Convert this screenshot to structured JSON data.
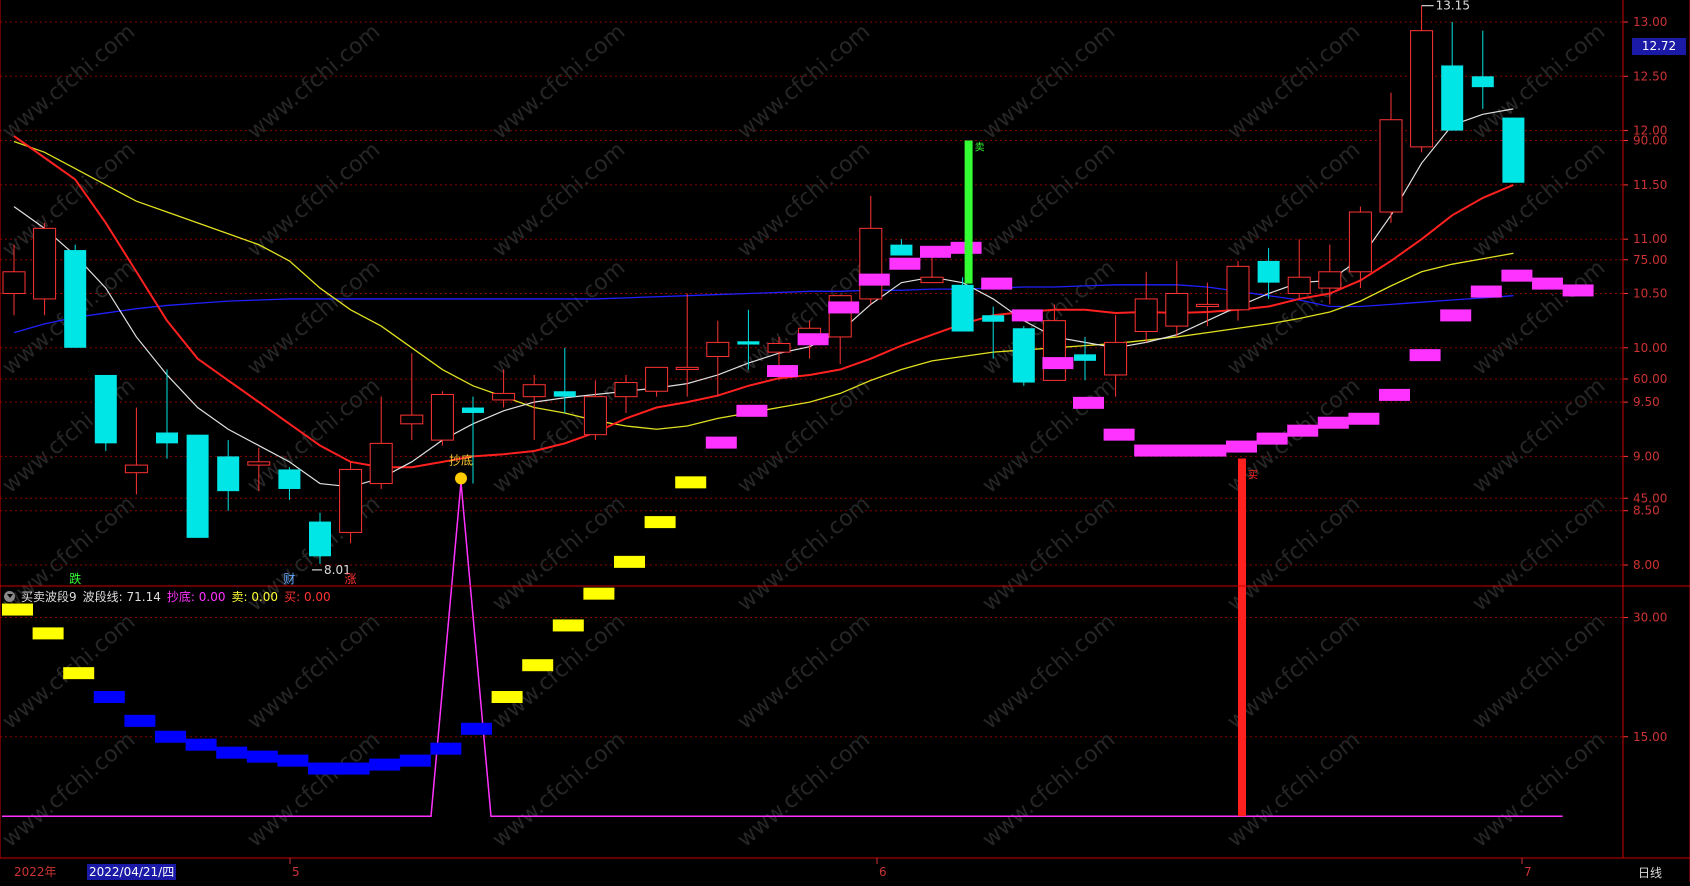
{
  "indicator": {
    "name": "买卖波段9",
    "items": [
      {
        "label": "波段线:",
        "value": "71.14",
        "cls": "lbl-w"
      },
      {
        "label": "抄底:",
        "value": "0.00",
        "cls": "lbl-m"
      },
      {
        "label": "卖:",
        "value": "0.00",
        "cls": "lbl-y"
      },
      {
        "label": "买:",
        "value": "0.00",
        "cls": "lbl-r"
      }
    ],
    "bottom_label": "抄底",
    "sell_mark": "卖",
    "buy_mark": "买"
  },
  "current_price": "12.72",
  "period_label": "日线",
  "dates": {
    "year": "2022年",
    "cursor_date": "2022/04/21/四",
    "months": [
      "5",
      "6",
      "7"
    ]
  },
  "watermark": "www.cfchi.com",
  "colors": {
    "up": "#ff3333",
    "down": "#00e5e5",
    "ma5": "#e0e0e0",
    "ma10": "#ff2020",
    "ma20": "#e0e020",
    "ma60": "#2020ff",
    "grid": "#8b0000",
    "osc_pink": "#ff33ff",
    "osc_yellow": "#ffff00",
    "osc_blue": "#0000ff"
  },
  "chart_data": [
    {
      "type": "candlestick",
      "y_ticks": [
        "13.00",
        "12.50",
        "12.00",
        "11.50",
        "11.00",
        "10.50",
        "10.00",
        "9.50",
        "9.00",
        "8.50",
        "8.00"
      ],
      "ylim": [
        7.9,
        13.2
      ],
      "annotations": {
        "high": "13.15",
        "low": "8.01"
      },
      "markers": [
        {
          "index": 2,
          "text": "跌",
          "color": "#33ff33"
        },
        {
          "index": 9,
          "text": "财",
          "color": "#66aaff"
        },
        {
          "index": 11,
          "text": "涨",
          "color": "#ff3333"
        }
      ],
      "candles": [
        {
          "o": 10.5,
          "h": 10.95,
          "l": 10.3,
          "c": 10.7
        },
        {
          "o": 10.45,
          "h": 11.15,
          "l": 10.3,
          "c": 11.1
        },
        {
          "o": 10.9,
          "h": 10.95,
          "l": 10.0,
          "c": 10.0
        },
        {
          "o": 9.75,
          "h": 9.75,
          "l": 9.05,
          "c": 9.12
        },
        {
          "o": 8.85,
          "h": 9.45,
          "l": 8.65,
          "c": 8.92
        },
        {
          "o": 9.22,
          "h": 9.8,
          "l": 8.98,
          "c": 9.12
        },
        {
          "o": 9.2,
          "h": 9.2,
          "l": 8.25,
          "c": 8.25
        },
        {
          "o": 9.0,
          "h": 9.15,
          "l": 8.5,
          "c": 8.68
        },
        {
          "o": 8.92,
          "h": 9.08,
          "l": 8.68,
          "c": 8.95
        },
        {
          "o": 8.88,
          "h": 8.9,
          "l": 8.6,
          "c": 8.7
        },
        {
          "o": 8.4,
          "h": 8.48,
          "l": 8.01,
          "c": 8.08
        },
        {
          "o": 8.3,
          "h": 8.95,
          "l": 8.2,
          "c": 8.88
        },
        {
          "o": 8.75,
          "h": 9.55,
          "l": 8.7,
          "c": 9.12
        },
        {
          "o": 9.3,
          "h": 9.95,
          "l": 9.15,
          "c": 9.38
        },
        {
          "o": 9.15,
          "h": 9.6,
          "l": 9.1,
          "c": 9.57
        },
        {
          "o": 9.45,
          "h": 9.55,
          "l": 8.75,
          "c": 9.4
        },
        {
          "o": 9.52,
          "h": 9.8,
          "l": 9.45,
          "c": 9.58
        },
        {
          "o": 9.55,
          "h": 9.75,
          "l": 9.15,
          "c": 9.66
        },
        {
          "o": 9.6,
          "h": 10.0,
          "l": 9.4,
          "c": 9.55
        },
        {
          "o": 9.2,
          "h": 9.7,
          "l": 9.15,
          "c": 9.55
        },
        {
          "o": 9.55,
          "h": 9.75,
          "l": 9.4,
          "c": 9.68
        },
        {
          "o": 9.6,
          "h": 9.8,
          "l": 9.55,
          "c": 9.82
        },
        {
          "o": 9.8,
          "h": 10.5,
          "l": 9.55,
          "c": 9.82
        },
        {
          "o": 9.92,
          "h": 10.25,
          "l": 9.55,
          "c": 10.05
        },
        {
          "o": 10.06,
          "h": 10.35,
          "l": 9.8,
          "c": 10.03
        },
        {
          "o": 9.96,
          "h": 10.1,
          "l": 9.7,
          "c": 10.04
        },
        {
          "o": 10.03,
          "h": 10.25,
          "l": 9.9,
          "c": 10.18
        },
        {
          "o": 10.1,
          "h": 10.48,
          "l": 9.85,
          "c": 10.48
        },
        {
          "o": 10.45,
          "h": 11.4,
          "l": 10.4,
          "c": 11.1
        },
        {
          "o": 10.95,
          "h": 11.0,
          "l": 10.85,
          "c": 10.85
        },
        {
          "o": 10.6,
          "h": 10.85,
          "l": 10.6,
          "c": 10.65
        },
        {
          "o": 10.58,
          "h": 10.65,
          "l": 10.15,
          "c": 10.15
        },
        {
          "o": 10.3,
          "h": 10.38,
          "l": 9.9,
          "c": 10.24
        },
        {
          "o": 10.18,
          "h": 10.2,
          "l": 9.65,
          "c": 9.68
        },
        {
          "o": 9.7,
          "h": 10.4,
          "l": 9.7,
          "c": 10.25
        },
        {
          "o": 9.94,
          "h": 10.1,
          "l": 9.7,
          "c": 9.88
        },
        {
          "o": 9.75,
          "h": 10.3,
          "l": 9.55,
          "c": 10.05
        },
        {
          "o": 10.15,
          "h": 10.7,
          "l": 10.05,
          "c": 10.45
        },
        {
          "o": 10.2,
          "h": 10.8,
          "l": 10.1,
          "c": 10.5
        },
        {
          "o": 10.38,
          "h": 10.6,
          "l": 10.2,
          "c": 10.4
        },
        {
          "o": 10.35,
          "h": 10.8,
          "l": 10.25,
          "c": 10.75
        },
        {
          "o": 10.8,
          "h": 10.92,
          "l": 10.45,
          "c": 10.6
        },
        {
          "o": 10.5,
          "h": 11.0,
          "l": 10.45,
          "c": 10.65
        },
        {
          "o": 10.55,
          "h": 10.95,
          "l": 10.4,
          "c": 10.7
        },
        {
          "o": 10.7,
          "h": 11.3,
          "l": 10.55,
          "c": 11.25
        },
        {
          "o": 11.25,
          "h": 12.35,
          "l": 11.15,
          "c": 12.1
        },
        {
          "o": 11.85,
          "h": 13.15,
          "l": 11.8,
          "c": 12.92
        },
        {
          "o": 12.6,
          "h": 13.0,
          "l": 12.0,
          "c": 12.0
        },
        {
          "o": 12.5,
          "h": 12.92,
          "l": 12.2,
          "c": 12.4
        },
        {
          "o": 12.12,
          "h": 12.12,
          "l": 11.52,
          "c": 11.52
        }
      ],
      "ma5": [
        11.3,
        11.1,
        10.85,
        10.55,
        10.1,
        9.75,
        9.45,
        9.25,
        9.1,
        8.95,
        8.75,
        8.72,
        8.8,
        8.95,
        9.15,
        9.3,
        9.42,
        9.5,
        9.54,
        9.57,
        9.6,
        9.63,
        9.67,
        9.75,
        9.86,
        9.95,
        10.01,
        10.15,
        10.4,
        10.6,
        10.65,
        10.6,
        10.45,
        10.25,
        10.1,
        10.05,
        10.0,
        10.05,
        10.12,
        10.25,
        10.38,
        10.5,
        10.6,
        10.62,
        10.82,
        11.22,
        11.7,
        12.05,
        12.15,
        12.2
      ],
      "ma10": [
        11.95,
        11.75,
        11.55,
        11.15,
        10.7,
        10.25,
        9.9,
        9.7,
        9.5,
        9.3,
        9.1,
        8.95,
        8.9,
        8.9,
        8.95,
        9.0,
        9.02,
        9.05,
        9.12,
        9.22,
        9.35,
        9.45,
        9.5,
        9.56,
        9.65,
        9.72,
        9.75,
        9.8,
        9.9,
        10.02,
        10.12,
        10.22,
        10.3,
        10.33,
        10.35,
        10.35,
        10.32,
        10.33,
        10.32,
        10.33,
        10.35,
        10.38,
        10.45,
        10.5,
        10.62,
        10.8,
        11.0,
        11.22,
        11.38,
        11.5
      ],
      "ma20": [
        11.9,
        11.8,
        11.65,
        11.5,
        11.35,
        11.25,
        11.15,
        11.05,
        10.95,
        10.8,
        10.55,
        10.35,
        10.2,
        10.0,
        9.8,
        9.65,
        9.55,
        9.45,
        9.4,
        9.33,
        9.28,
        9.25,
        9.28,
        9.35,
        9.4,
        9.45,
        9.5,
        9.58,
        9.7,
        9.8,
        9.88,
        9.92,
        9.96,
        9.98,
        10.0,
        10.02,
        10.04,
        10.07,
        10.1,
        10.14,
        10.18,
        10.22,
        10.27,
        10.33,
        10.43,
        10.57,
        10.7,
        10.77,
        10.82,
        10.87
      ],
      "ma60": [
        10.14,
        10.22,
        10.28,
        10.32,
        10.36,
        10.39,
        10.41,
        10.43,
        10.44,
        10.45,
        10.45,
        10.45,
        10.45,
        10.45,
        10.45,
        10.45,
        10.45,
        10.45,
        10.45,
        10.45,
        10.46,
        10.47,
        10.48,
        10.49,
        10.5,
        10.51,
        10.52,
        10.52,
        10.53,
        10.53,
        10.54,
        10.54,
        10.55,
        10.56,
        10.56,
        10.57,
        10.58,
        10.58,
        10.58,
        10.56,
        10.52,
        10.48,
        10.44,
        10.38,
        10.38,
        10.4,
        10.42,
        10.44,
        10.46,
        10.48
      ]
    },
    {
      "type": "oscillator",
      "y_ticks": [
        "90.00",
        "75.00",
        "60.00",
        "45.00",
        "30.00",
        "15.00"
      ],
      "ylim": [
        3,
        97
      ],
      "wave": [
        31,
        28,
        23,
        20,
        17,
        15,
        14,
        13,
        12.5,
        12,
        11,
        11,
        11.5,
        12,
        13.5,
        16,
        20,
        24,
        29,
        33,
        37,
        42,
        47,
        52,
        56,
        61,
        65,
        69,
        72.5,
        74.5,
        76,
        76.5,
        72,
        68,
        62,
        57,
        53,
        51,
        51,
        51,
        51.5,
        52.5,
        53.5,
        54.5,
        55,
        58,
        63,
        68,
        71,
        73,
        72,
        71.14
      ],
      "wave_colors": [
        "y",
        "y",
        "y",
        "b",
        "b",
        "b",
        "b",
        "b",
        "b",
        "b",
        "b",
        "b",
        "b",
        "b",
        "b",
        "b",
        "y",
        "y",
        "y",
        "y",
        "y",
        "y",
        "y",
        "p",
        "p",
        "p",
        "p",
        "p",
        "p",
        "p",
        "p",
        "p",
        "p",
        "p",
        "p",
        "p",
        "p",
        "p",
        "p",
        "p",
        "p",
        "p",
        "p",
        "p",
        "p",
        "p",
        "p",
        "p",
        "p",
        "p",
        "p",
        "p"
      ],
      "baseline": 5,
      "bottom_spike": {
        "index": 15,
        "value": 47
      },
      "sell_bar": {
        "index": 31,
        "from": 72,
        "to": 90
      },
      "buy_bar": {
        "index": 40,
        "from": 5,
        "to": 50
      }
    }
  ]
}
